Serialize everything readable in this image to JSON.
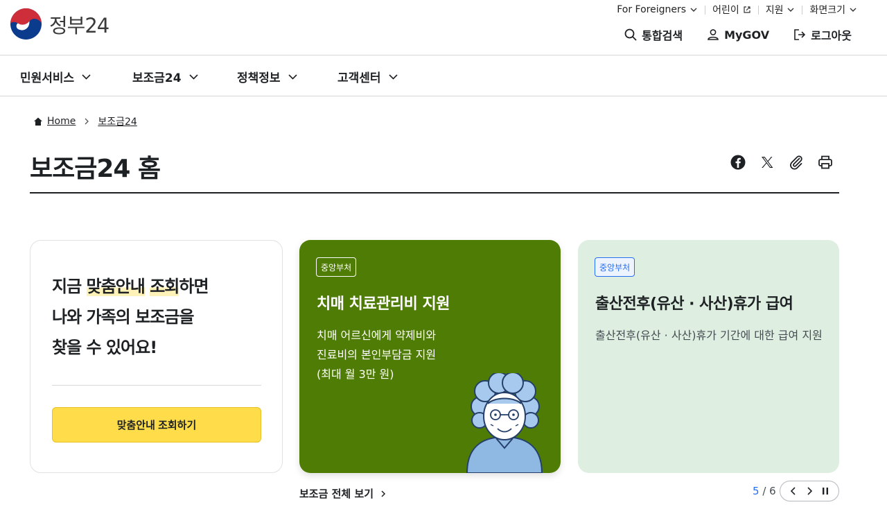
{
  "header": {
    "logo_text": "정부24",
    "util": {
      "foreigners": "For Foreigners",
      "kids": "어린이",
      "support": "지원",
      "font_size": "화면크기"
    },
    "search": "통합검색",
    "mygov": "MyGOV",
    "logout": "로그아웃"
  },
  "nav": {
    "items": [
      "민원서비스",
      "보조금24",
      "정책정보",
      "고객센터"
    ]
  },
  "breadcrumb": {
    "home": "Home",
    "current": "보조금24"
  },
  "page": {
    "title": "보조금24 홈"
  },
  "info_card": {
    "line1_pre": "지금 ",
    "line1_hl1": "맞춤안내",
    "line1_mid": " ",
    "line1_hl2": "조회",
    "line1_post": "하면",
    "line2": "나와 가족의 보조금을",
    "line3": "찾을 수 있어요!",
    "button": "맞춤안내 조회하기"
  },
  "cards": [
    {
      "badge": "중앙부처",
      "title": "치매 치료관리비 지원",
      "desc_lines": [
        "치매 어르신에게 약제비와",
        "진료비의 본인부담금 지원",
        "(최대 월 3만 원)"
      ],
      "color": "#4f7c05"
    },
    {
      "badge": "중앙부처",
      "title": "출산전후(유산 · 사산)휴가 급여",
      "desc": "출산전후(유산 · 사산)휴가 기간에 대한 급여 지원",
      "color": "#deefe1"
    }
  ],
  "bottom": {
    "view_all": "보조금 전체 보기",
    "page_current": "5",
    "page_total": "/ 6"
  },
  "icons": [
    "search-icon",
    "user-icon",
    "logout-icon",
    "facebook-icon",
    "x-icon",
    "link-icon",
    "print-icon",
    "home-icon"
  ]
}
